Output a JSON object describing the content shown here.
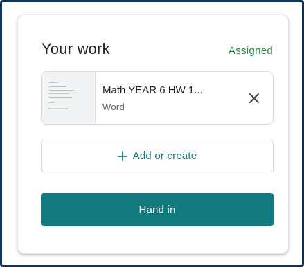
{
  "card": {
    "title": "Your work",
    "status": "Assigned",
    "attachment": {
      "name": "Math YEAR 6 HW 1...",
      "type": "Word",
      "thumbnail_icon": "document-thumbnail",
      "remove_icon": "close-icon"
    },
    "add_button": {
      "label": "Add or create",
      "icon": "plus-icon"
    },
    "hand_in_button": {
      "label": "Hand in"
    }
  },
  "colors": {
    "accent": "#137a7f",
    "status_green": "#1e8e3e",
    "frame_border": "#0d3357"
  }
}
